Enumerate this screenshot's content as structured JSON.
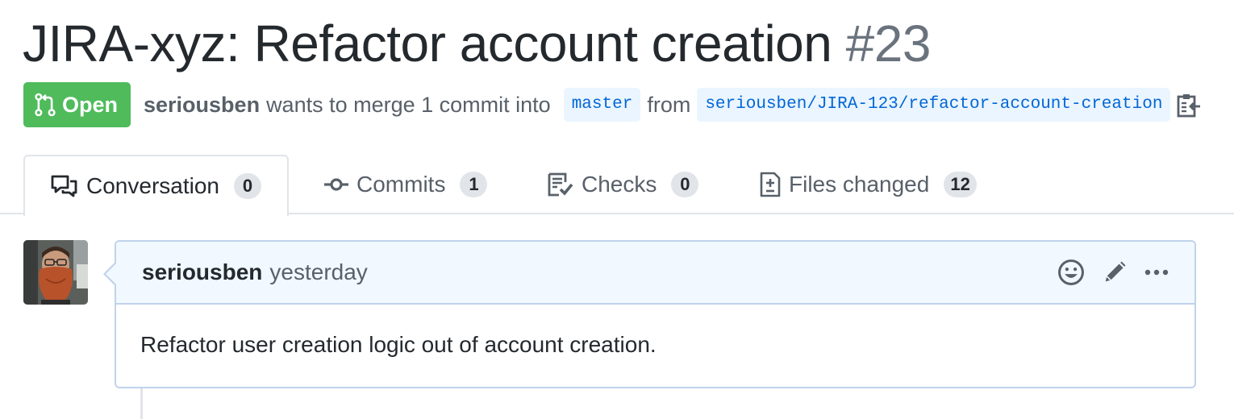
{
  "pr": {
    "title": "JIRA-xyz: Refactor account creation",
    "number": "#23",
    "state": "Open",
    "author": "seriousben",
    "merge_text": "wants to merge 1 commit into",
    "base_branch": "master",
    "from_text": "from",
    "head_branch": "seriousben/JIRA-123/refactor-account-creation"
  },
  "tabs": [
    {
      "label": "Conversation",
      "count": "0",
      "icon": "comment-discussion-icon"
    },
    {
      "label": "Commits",
      "count": "1",
      "icon": "git-commit-icon"
    },
    {
      "label": "Checks",
      "count": "0",
      "icon": "checklist-icon"
    },
    {
      "label": "Files changed",
      "count": "12",
      "icon": "file-diff-icon"
    }
  ],
  "comment": {
    "author": "seriousben",
    "time": "yesterday",
    "body": "Refactor user creation logic out of account creation."
  },
  "colors": {
    "open_badge": "#4fbb5b",
    "link_blue": "#0366d6",
    "comment_header_bg": "#f1f8ff",
    "comment_border": "#c0d3eb"
  }
}
